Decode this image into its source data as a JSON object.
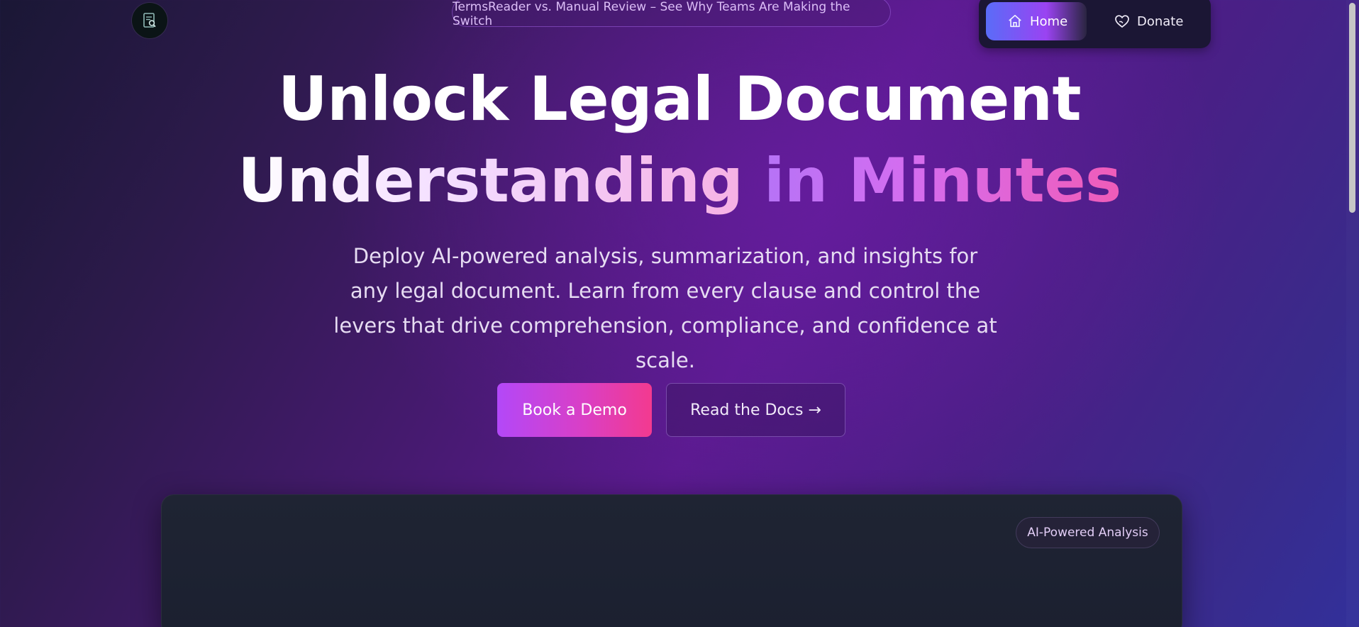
{
  "banner": {
    "text": "TermsReader vs. Manual Review – See Why Teams Are Making the Switch"
  },
  "logo": {
    "icon": "document-search-icon"
  },
  "nav": {
    "items": [
      {
        "label": "Home",
        "icon": "home-icon",
        "active": true
      },
      {
        "label": "Donate",
        "icon": "heart-hand-icon",
        "active": false
      }
    ]
  },
  "hero": {
    "title_line1": "Unlock Legal Document",
    "title_line2_a": "Understanding",
    "title_line2_b": "in Minutes",
    "subtitle": "Deploy AI-powered analysis, summarization, and insights for any legal document. Learn from every clause and control the levers that drive comprehension, compliance, and confidence at scale."
  },
  "cta": {
    "primary_label": "Book a Demo",
    "secondary_label": "Read the Docs →"
  },
  "panel": {
    "badge": "AI-Powered Analysis"
  },
  "colors": {
    "accent_purple": "#b348f8",
    "accent_pink": "#f33a8f",
    "nav_active_start": "#5a6cf8"
  }
}
